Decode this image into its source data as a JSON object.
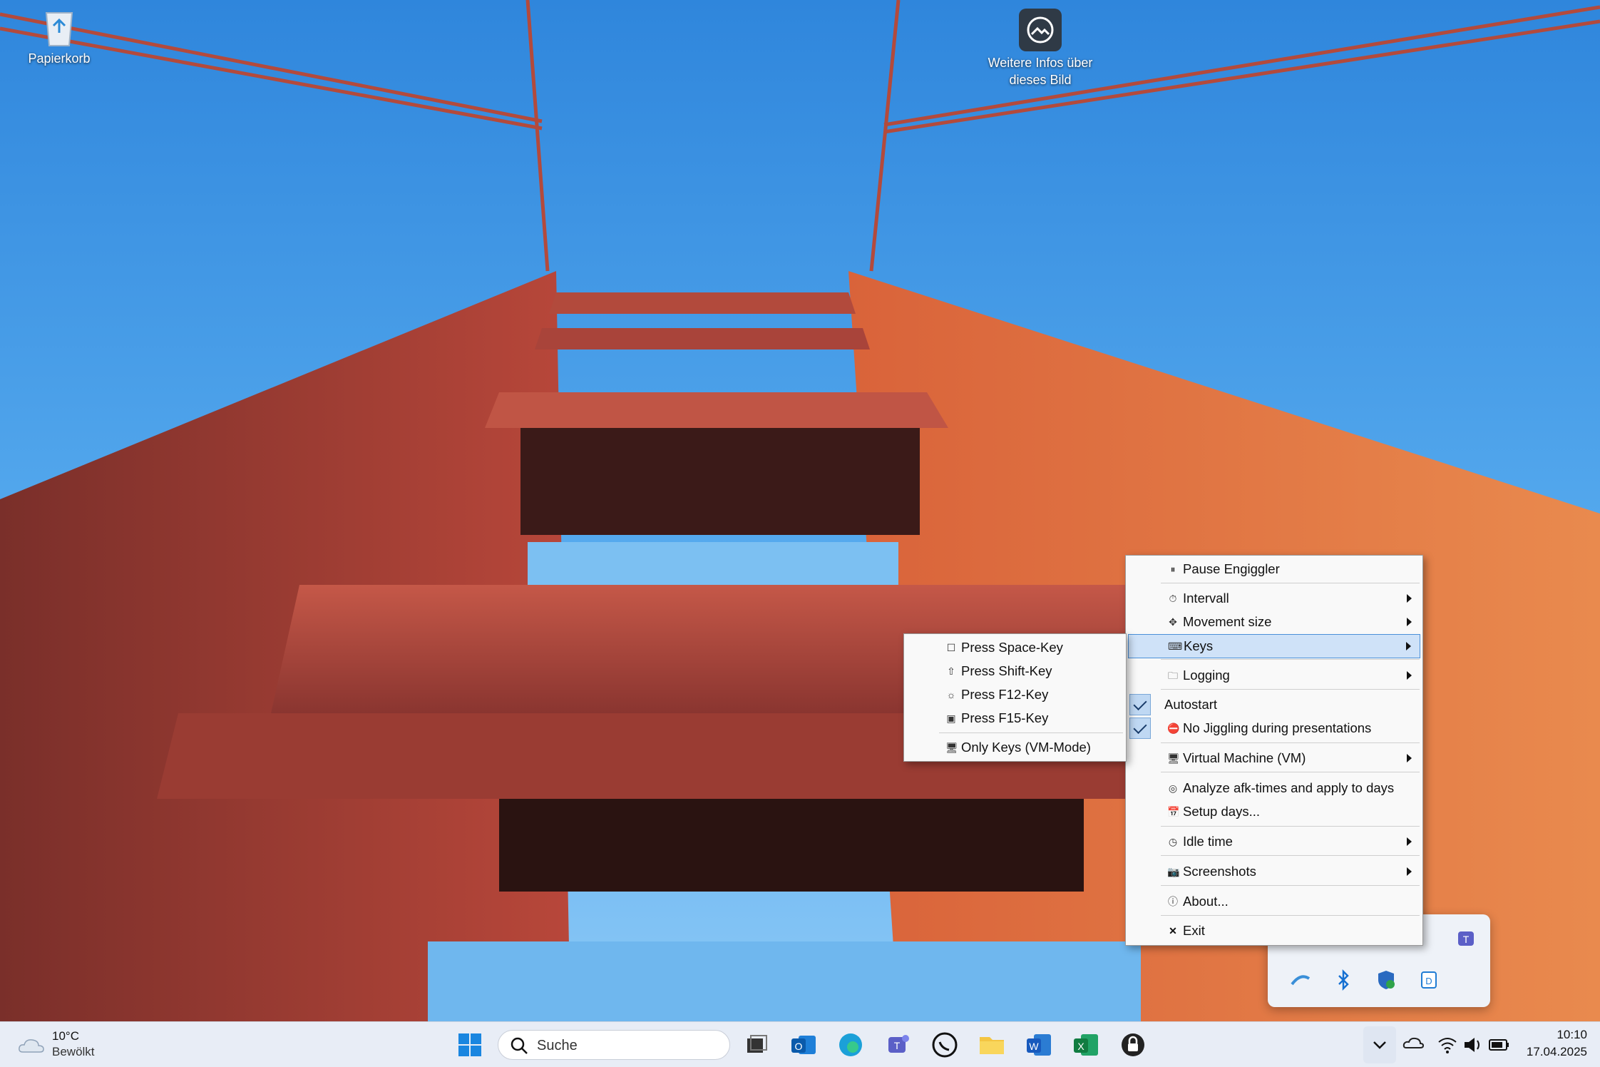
{
  "desktop": {
    "icons": [
      {
        "label": "Papierkorb",
        "icon": "recycle-bin-icon"
      },
      {
        "label_line1": "Weitere Infos über",
        "label_line2": "dieses Bild",
        "icon": "image-info-icon"
      }
    ]
  },
  "context_menu": {
    "items": [
      {
        "label": "Pause Engiggler",
        "icon": "pause-icon"
      },
      {
        "label": "Intervall",
        "icon": "timer-icon",
        "submenu": true
      },
      {
        "label": "Movement size",
        "icon": "movement-icon",
        "submenu": true
      },
      {
        "label": "Keys",
        "icon": "keyboard-icon",
        "submenu": true,
        "highlighted": true
      },
      {
        "label": "Logging",
        "icon": "folder-icon",
        "submenu": true
      },
      {
        "label": "Autostart",
        "checked": true
      },
      {
        "label": "No Jiggling during presentations",
        "icon": "no-entry-icon",
        "checked": true
      },
      {
        "label": "Virtual Machine (VM)",
        "icon": "monitor-icon",
        "submenu": true
      },
      {
        "label": "Analyze afk-times and apply to days",
        "icon": "analyze-icon"
      },
      {
        "label": "Setup days...",
        "icon": "calendar-icon"
      },
      {
        "label": "Idle time",
        "icon": "clock-icon",
        "submenu": true
      },
      {
        "label": "Screenshots",
        "icon": "camera-icon",
        "submenu": true
      },
      {
        "label": "About...",
        "icon": "info-icon"
      },
      {
        "label": "Exit",
        "icon": "close-icon"
      }
    ]
  },
  "keys_submenu": {
    "items": [
      {
        "label": "Press Space-Key",
        "icon": "space-key-icon"
      },
      {
        "label": "Press Shift-Key",
        "icon": "shift-key-icon"
      },
      {
        "label": "Press F12-Key",
        "icon": "f12-key-icon"
      },
      {
        "label": "Press F15-Key",
        "icon": "f15-key-icon"
      },
      {
        "label": "Only Keys (VM-Mode)",
        "icon": "vm-mode-icon"
      }
    ]
  },
  "taskbar": {
    "weather": {
      "temp": "10°C",
      "condition": "Bewölkt"
    },
    "search_placeholder": "Suche",
    "apps": [
      "start-icon",
      "task-view-icon",
      "outlook-icon",
      "edge-icon",
      "teams-icon",
      "whatsapp-icon",
      "file-explorer-icon",
      "word-icon",
      "excel-icon",
      "keepass-icon"
    ],
    "clock": {
      "time": "10:10",
      "date": "17.04.2025"
    }
  },
  "colors": {
    "sky": "#4a9be0",
    "bridge": "#c0503a",
    "menu_highlight": "#cfe2f8",
    "taskbar": "#e8edf6"
  }
}
